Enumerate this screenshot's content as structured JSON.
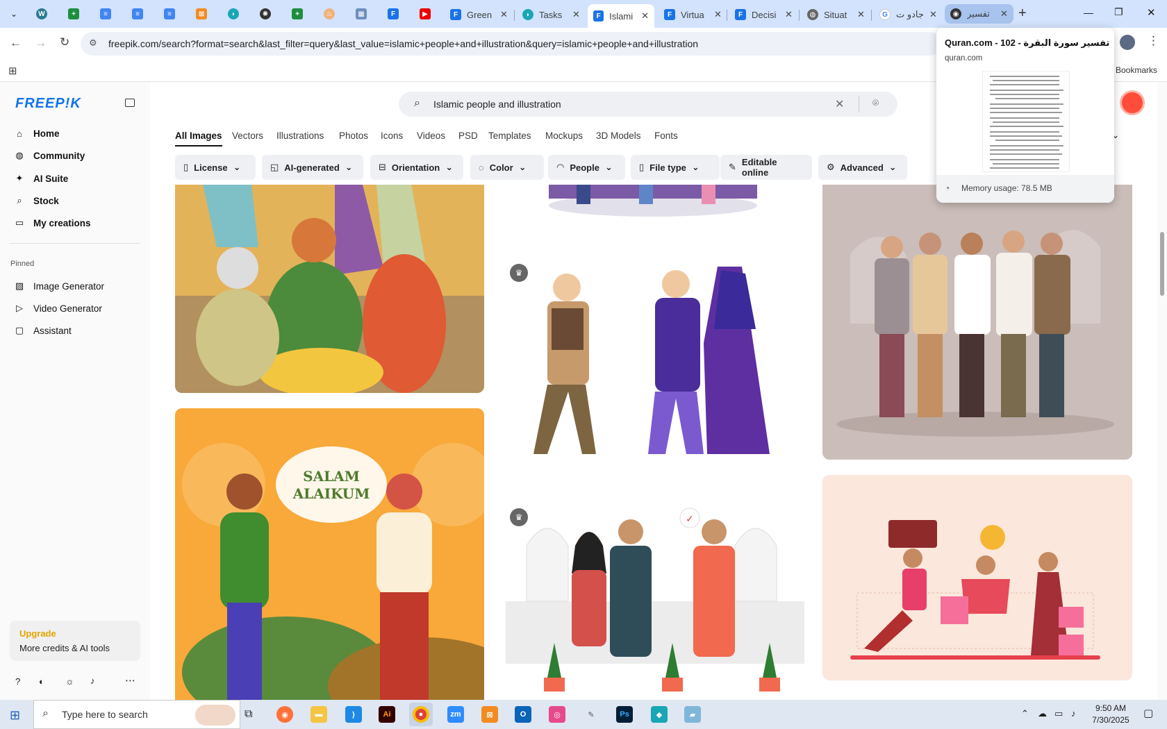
{
  "browser": {
    "tabs": [
      {
        "title": "Green",
        "icon": "docs-icon"
      },
      {
        "title": "Tasks",
        "icon": "tasks-icon"
      },
      {
        "title": "Islami",
        "icon": "docs-icon",
        "active": true
      },
      {
        "title": "Virtua",
        "icon": "docs-icon"
      },
      {
        "title": "Decisi",
        "icon": "docs-icon"
      },
      {
        "title": "Situat",
        "icon": "globe-icon"
      },
      {
        "title": "جادو ت",
        "icon": "google-icon"
      },
      {
        "title": "تفسير",
        "icon": "quran-icon"
      }
    ],
    "url": "freepik.com/search?format=search&last_filter=query&last_value=islamic+people+and+illustration&query=islamic+people+and+illustration",
    "bookmarks_label": "Bookmarks",
    "close_glyph": "✕",
    "new_tab_glyph": "+"
  },
  "tab_hover": {
    "title": "Quran.com - 102 - تفسير سورة البقرة",
    "domain": "quran.com",
    "memory": "Memory usage: 78.5 MB"
  },
  "sidebar": {
    "logo": "FREEP!K",
    "nav": [
      {
        "label": "Home",
        "icon": "home-icon"
      },
      {
        "label": "Community",
        "icon": "globe-icon"
      },
      {
        "label": "AI Suite",
        "icon": "sparkle-icon"
      },
      {
        "label": "Stock",
        "icon": "search-icon"
      },
      {
        "label": "My creations",
        "icon": "folder-icon"
      }
    ],
    "pinned_label": "Pinned",
    "pinned": [
      {
        "label": "Image Generator",
        "icon": "image-icon"
      },
      {
        "label": "Video Generator",
        "icon": "video-icon"
      },
      {
        "label": "Assistant",
        "icon": "chat-icon"
      }
    ],
    "upgrade": {
      "title": "Upgrade",
      "subtitle": "More credits & AI tools"
    }
  },
  "search": {
    "query": "Islamic people and illustration"
  },
  "categories": [
    "All Images",
    "Vectors",
    "Illustrations",
    "Photos",
    "Icons",
    "Videos",
    "PSD",
    "Templates",
    "Mockups",
    "3D Models",
    "Fonts"
  ],
  "filters": [
    "License",
    "AI-generated",
    "Orientation",
    "Color",
    "People",
    "File type",
    "Editable online",
    "Advanced"
  ],
  "cards": {
    "salam_text_1": "SALAM",
    "salam_text_2": "ALAIKUM"
  },
  "taskbar": {
    "search_placeholder": "Type here to search",
    "time": "9:50 AM",
    "date": "7/30/2025"
  },
  "colors": {
    "brand": "#1273eb",
    "tabstrip": "#d3e3fd",
    "upgrade": "#e3a300"
  }
}
